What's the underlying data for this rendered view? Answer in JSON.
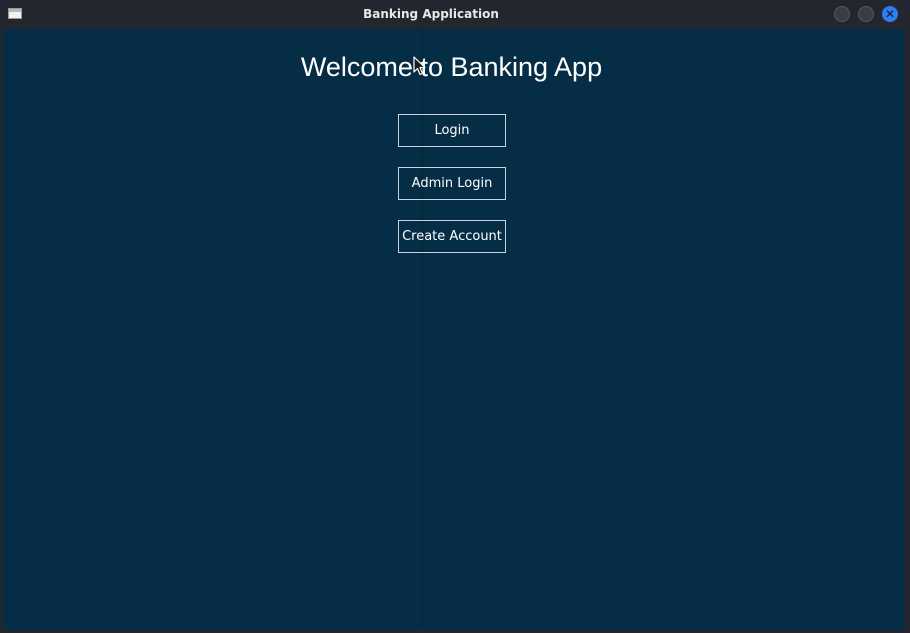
{
  "window": {
    "title": "Banking Application",
    "icon": "window-icon",
    "controls": [
      "minimize-icon",
      "maximize-icon",
      "close-icon"
    ],
    "close_glyph": "✕"
  },
  "main": {
    "heading": "Welcome to Banking App",
    "buttons": {
      "login": "Login",
      "admin_login": "Admin Login",
      "create_account": "Create Account"
    }
  },
  "colors": {
    "background": "#062d46",
    "titlebar": "#23262e",
    "accent_close": "#2f7df4",
    "text": "#ffffff"
  }
}
